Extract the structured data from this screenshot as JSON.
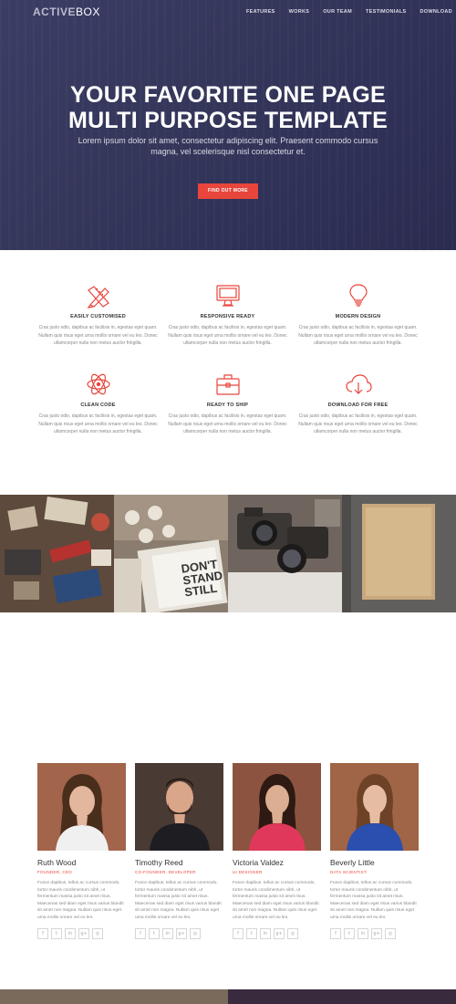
{
  "logo": {
    "part1": "ACTIVE",
    "part2": "BOX"
  },
  "nav": {
    "items": [
      "FEATURES",
      "WORKS",
      "OUR TEAM",
      "TESTIMONIALS",
      "DOWNLOAD"
    ]
  },
  "hero": {
    "title_line1": "YOUR FAVORITE ONE PAGE",
    "title_line2": "MULTI PURPOSE TEMPLATE",
    "lead": "Lorem ipsum dolor sit amet, consectetur adipiscing elit. Praesent commodo cursus magna, vel scelerisque nisl consectetur et.",
    "cta": "FIND OUT MORE",
    "colors": {
      "background": "#32345a",
      "cta": "#e8453c"
    }
  },
  "features": [
    {
      "icon": "pencil-ruler-icon",
      "title": "EASILY CUSTOMISED",
      "text": "Cras justo odio, dapibus ac facilisis in, egestas eget quam. Nullam quis risus eget urna mollis ornare vel eu leo. Donec ullamcorper nulla non metus auctor fringilla."
    },
    {
      "icon": "monitor-icon",
      "title": "RESPONSIVE READY",
      "text": "Cras justo odio, dapibus ac facilisis in, egestas eget quam. Nullam quis risus eget urna mollis ornare vel eu leo. Donec ullamcorper nulla non metus auctor fringilla."
    },
    {
      "icon": "lightbulb-icon",
      "title": "MODERN DESIGN",
      "text": "Cras justo odio, dapibus ac facilisis in, egestas eget quam. Nullam quis risus eget urna mollis ornare vel eu leo. Donec ullamcorper nulla non metus auctor fringilla."
    },
    {
      "icon": "atom-icon",
      "title": "CLEAN CODE",
      "text": "Cras justo odio, dapibus ac facilisis in, egestas eget quam. Nullam quis risus eget urna mollis ornare vel eu leo. Donec ullamcorper nulla non metus auctor fringilla."
    },
    {
      "icon": "briefcase-icon",
      "title": "READY TO SHIP",
      "text": "Cras justo odio, dapibus ac facilisis in, egestas eget quam. Nullam quis risus eget urna mollis ornare vel eu leo. Donec ullamcorper nulla non metus auctor fringilla."
    },
    {
      "icon": "cloud-download-icon",
      "title": "DOWNLOAD FOR FREE",
      "text": "Cras justo odio, dapibus ac facilisis in, egestas eget quam. Nullam quis risus eget urna mollis ornare vel eu leo. Donec ullamcorper nulla non metus auctor fringilla."
    }
  ],
  "team": [
    {
      "name": "Ruth Wood",
      "role": "FOUNDER, CEO",
      "bio": "Fusce dapibus, tellus ac cursus commodo, tortor mauris condimentum nibh, ut fermentum massa justo sit amet risus. Maecenas sed diam eget risus varius blandit sit amet non magna. Nullam quis risus eget urna mollis ornare vel eu leo.",
      "palette": {
        "bg": "#9a5a3c",
        "hair": "#4a2e1c",
        "skin": "#e2b79d",
        "shirt": "#f0f0f0"
      }
    },
    {
      "name": "Timothy Reed",
      "role": "CO-FOUNDER, DEVELOPER",
      "bio": "Fusce dapibus, tellus ac cursus commodo, tortor mauris condimentum nibh, ut fermentum massa justo sit amet risus. Maecenas sed diam eget risus varius blandit sit amet non magna. Nullam quis risus eget urna mollis ornare vel eu leo.",
      "palette": {
        "bg": "#4a3a34",
        "hair": "#2a1c16",
        "skin": "#d9a68a",
        "shirt": "#1e1e22"
      }
    },
    {
      "name": "Victoria Valdez",
      "role": "UI DESIGNER",
      "bio": "Fusce dapibus, tellus ac cursus commodo, tortor mauris condimentum nibh, ut fermentum massa justo sit amet risus. Maecenas sed diam eget risus varius blandit sit amet non magna. Nullam quis risus eget urna mollis ornare vel eu leo.",
      "palette": {
        "bg": "#8c5440",
        "hair": "#2e1a12",
        "skin": "#dcae92",
        "shirt": "#e0385a"
      }
    },
    {
      "name": "Beverly Little",
      "role": "DATA SCIENTIST",
      "bio": "Fusce dapibus, tellus ac cursus commodo, tortor mauris condimentum nibh, ut fermentum massa justo sit amet risus. Maecenas sed diam eget risus varius blandit sit amet non magna. Nullam quis risus eget urna mollis ornare vel eu leo.",
      "palette": {
        "bg": "#a06446",
        "hair": "#6e4226",
        "skin": "#e6bda2",
        "shirt": "#2a4fae"
      }
    }
  ],
  "social_icons": [
    {
      "name": "facebook-icon",
      "glyph": "f"
    },
    {
      "name": "twitter-icon",
      "glyph": "t"
    },
    {
      "name": "linkedin-icon",
      "glyph": "in"
    },
    {
      "name": "google-plus-icon",
      "glyph": "g+"
    },
    {
      "name": "dribbble-icon",
      "glyph": "◎"
    }
  ],
  "colors": {
    "accent": "#e8453c",
    "heading": "#333333",
    "muted": "#888888"
  }
}
